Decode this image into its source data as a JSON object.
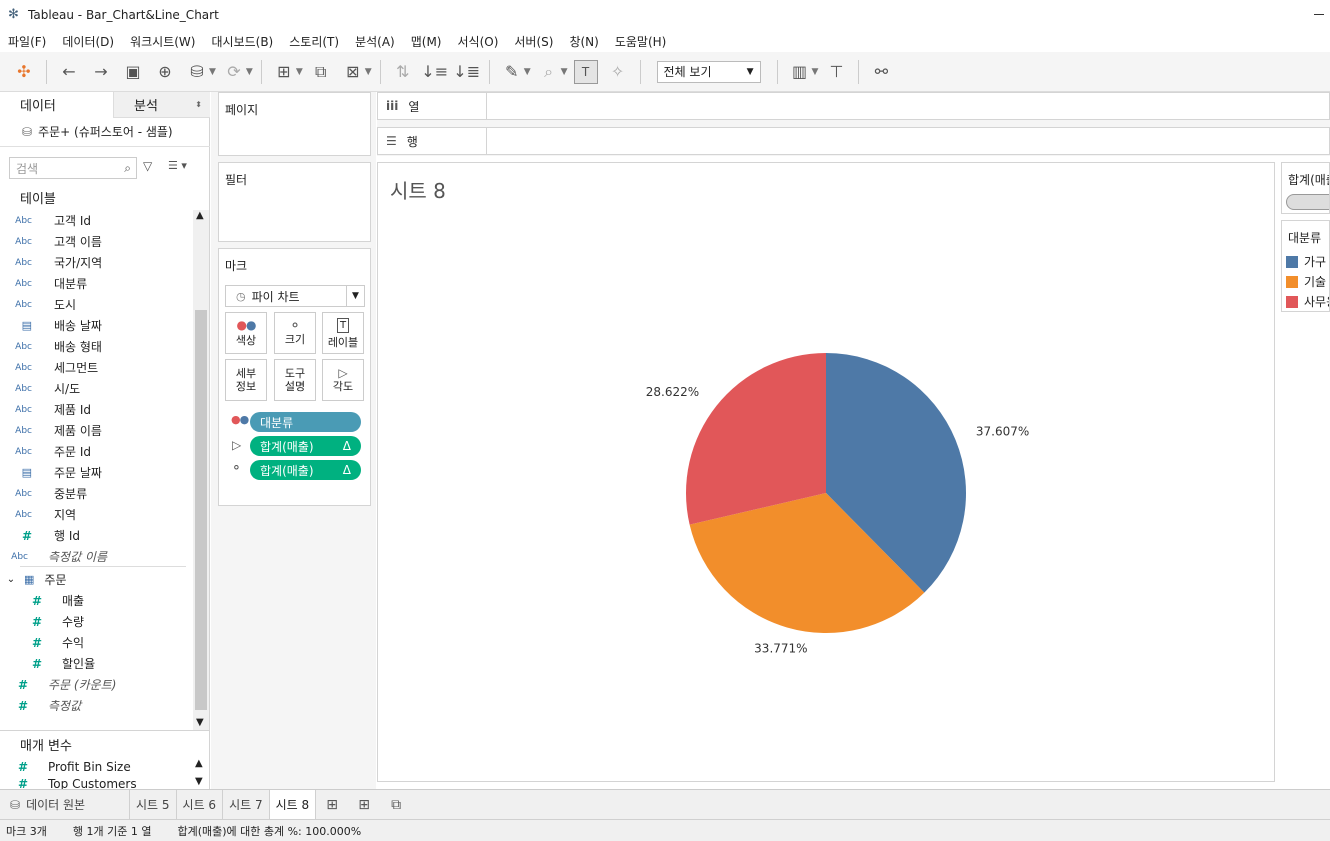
{
  "window": {
    "title": "Tableau - Bar_Chart&Line_Chart"
  },
  "menu": [
    "파일(F)",
    "데이터(D)",
    "워크시트(W)",
    "대시보드(B)",
    "스토리(T)",
    "분석(A)",
    "맵(M)",
    "서식(O)",
    "서버(S)",
    "창(N)",
    "도움말(H)"
  ],
  "toolbar": {
    "fit_label": "전체 보기"
  },
  "left_pane": {
    "tab_data": "데이터",
    "tab_analysis": "분석",
    "datasource": "주문+ (슈퍼스토어 - 샘플)",
    "search_placeholder": "검색",
    "tables_header": "테이블",
    "dimensions": [
      {
        "type": "Abc",
        "name": "고객 Id"
      },
      {
        "type": "Abc",
        "name": "고객 이름"
      },
      {
        "type": "Abc",
        "name": "국가/지역"
      },
      {
        "type": "Abc",
        "name": "대분류"
      },
      {
        "type": "Abc",
        "name": "도시"
      },
      {
        "type": "date",
        "name": "배송 날짜"
      },
      {
        "type": "Abc",
        "name": "배송 형태"
      },
      {
        "type": "Abc",
        "name": "세그먼트"
      },
      {
        "type": "Abc",
        "name": "시/도"
      },
      {
        "type": "Abc",
        "name": "제품 Id"
      },
      {
        "type": "Abc",
        "name": "제품 이름"
      },
      {
        "type": "Abc",
        "name": "주문 Id"
      },
      {
        "type": "date",
        "name": "주문 날짜"
      },
      {
        "type": "Abc",
        "name": "중분류"
      },
      {
        "type": "Abc",
        "name": "지역"
      },
      {
        "type": "#",
        "name": "행 Id"
      }
    ],
    "measure_names_label": "측정값 이름",
    "measure_table": "주문",
    "measures": [
      "매출",
      "수량",
      "수익",
      "할인율"
    ],
    "count_label": "주문 (카운트)",
    "measure_values_label": "측정값",
    "params_header": "매개 변수",
    "params": [
      "Profit Bin Size",
      "Top Customers"
    ],
    "type_abc": "Abc",
    "type_num": "#"
  },
  "cards": {
    "pages": "페이지",
    "filters": "필터",
    "marks": "마크",
    "mark_type": "파이 차트",
    "buttons": {
      "color": "색상",
      "size": "크기",
      "label": "레이블",
      "detail1": "세부",
      "detail2": "정보",
      "tooltip1": "도구",
      "tooltip2": "설명",
      "angle": "각도"
    },
    "pills": [
      "대분류",
      "합계(매출)",
      "합계(매출)"
    ]
  },
  "shelves": {
    "columns": "열",
    "rows": "행"
  },
  "sheet": {
    "title": "시트 8"
  },
  "legend": {
    "size_title": "합계(매출)",
    "color_title": "대분류",
    "items": [
      "가구",
      "기술",
      "사무용품"
    ]
  },
  "chart_data": {
    "type": "pie",
    "categories": [
      "가구",
      "기술",
      "사무용품"
    ],
    "values": [
      37.607,
      33.771,
      28.622
    ],
    "labels": [
      "37.607%",
      "33.771%",
      "28.622%"
    ],
    "colors": [
      "#4e79a7",
      "#f28e2b",
      "#e15759"
    ]
  },
  "bottom_tabs": {
    "datasource": "데이터 원본",
    "sheets": [
      "시트 5",
      "시트 6",
      "시트 7",
      "시트 8"
    ]
  },
  "status": {
    "marks": "마크 3개",
    "rows": "행 1개 기준 1 열",
    "summary": "합계(매출)에 대한 총계 %: 100.000%"
  }
}
